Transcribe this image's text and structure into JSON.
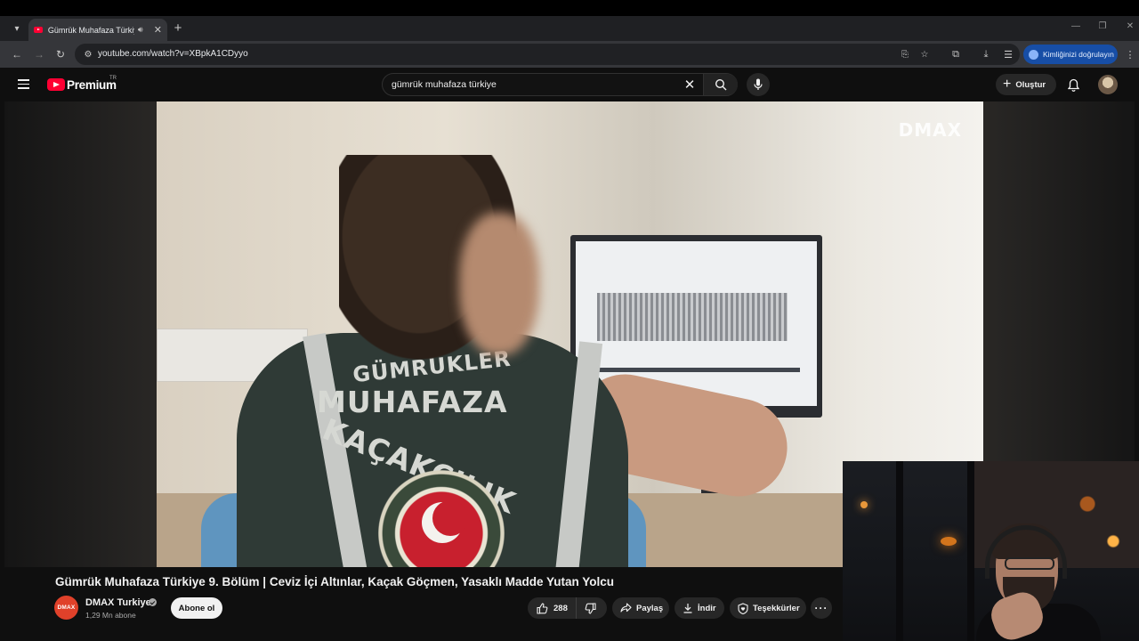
{
  "browser": {
    "tab": {
      "title": "Gümrük Muhafaza Türkiye",
      "favicon": "youtube-favicon",
      "audio_icon": "speaker-icon"
    },
    "url": "youtube.com/watch?v=XBpkA1CDyyo",
    "verify_identity_label": "Kimliğinizi doğrulayın"
  },
  "youtube": {
    "brand": "Premium",
    "country_code": "TR",
    "search_query": "gümrük muhafaza türkiye",
    "create_label": "Oluştur"
  },
  "video": {
    "watermark": "DMAX",
    "title": "Gümrük Muhafaza Türkiye 9. Bölüm | Ceviz İçi Altınlar, Kaçak Göçmen, Yasaklı Madde Yutan Yolcu",
    "vest_text": {
      "line1": "GÜMRÜKLER",
      "line2": "MUHAFAZA",
      "line3": "KAÇAKÇILIK"
    }
  },
  "channel": {
    "avatar_text": "DMAX",
    "name": "DMAX Turkiye",
    "subscribers": "1,29 Mn abone",
    "subscribe_label": "Abone ol"
  },
  "actions": {
    "likes": "288",
    "share_label": "Paylaş",
    "download_label": "İndir",
    "thanks_label": "Teşekkürler",
    "more_label": "···"
  },
  "colors": {
    "youtube_red": "#ff0033",
    "background": "#0f0f0f",
    "pill_bg": "#272727",
    "verify_pill": "#174ea6"
  }
}
